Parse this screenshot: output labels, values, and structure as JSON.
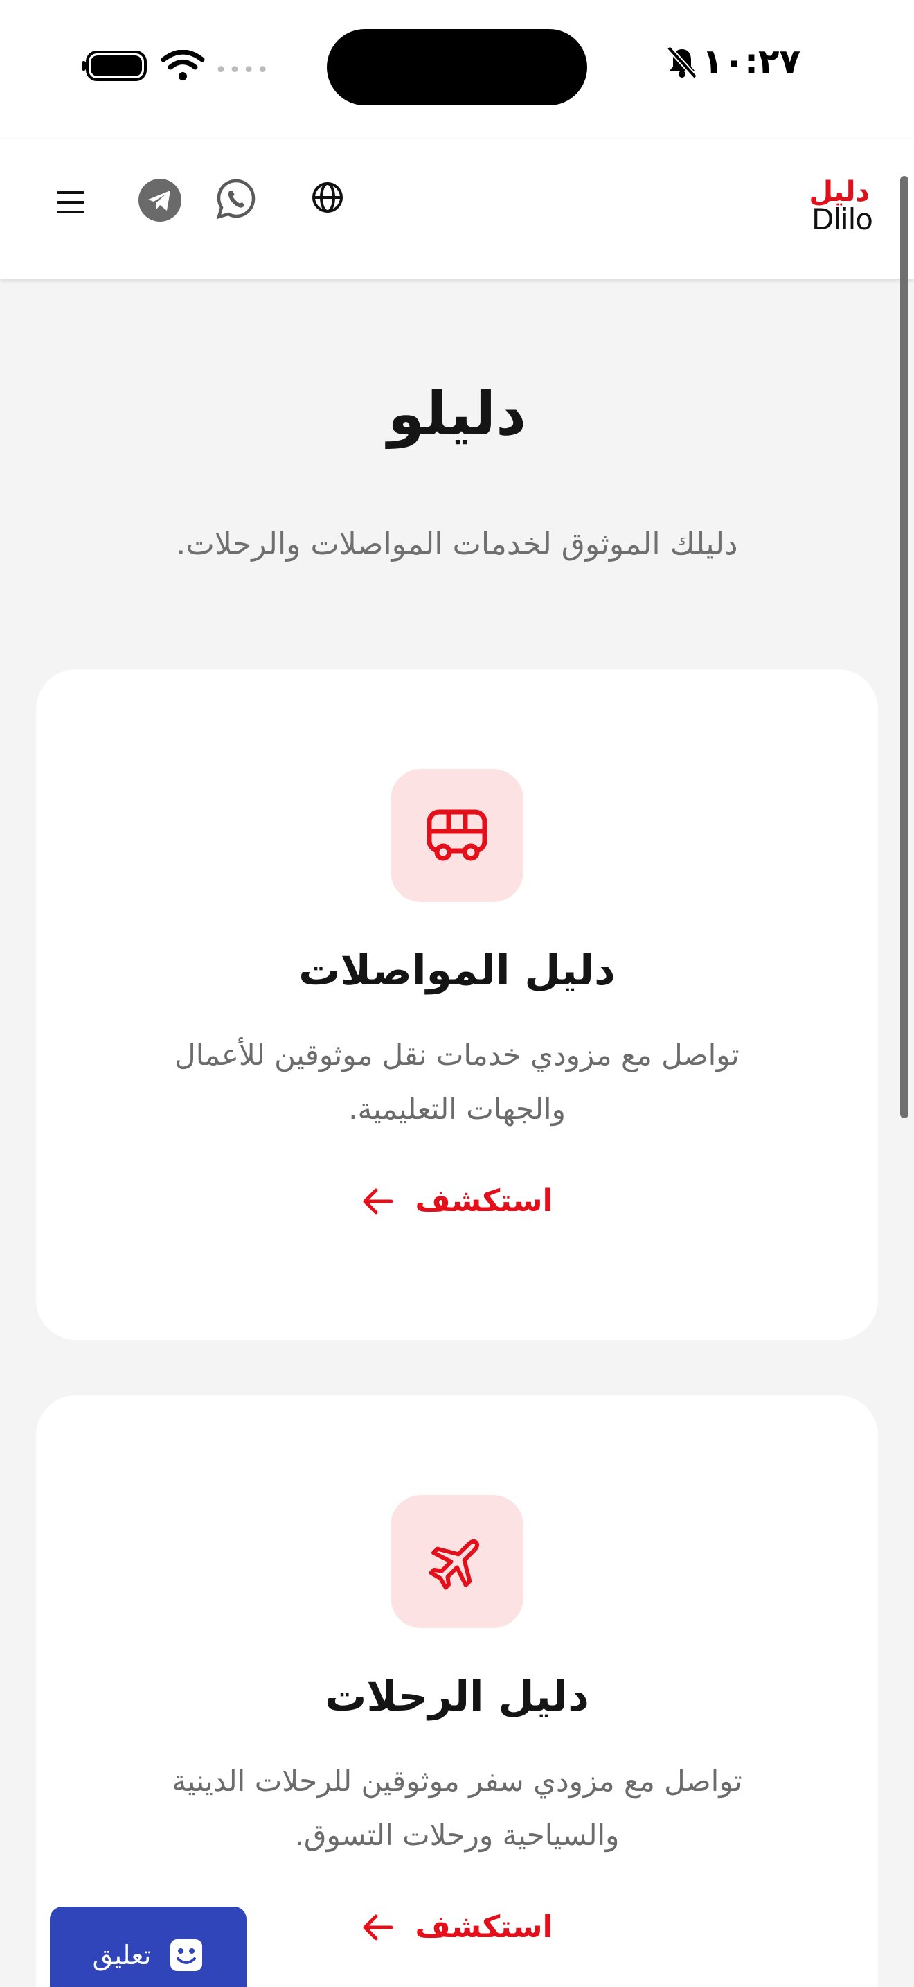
{
  "status_bar": {
    "time": "١٠:٢٧"
  },
  "header": {
    "logo_ar": "دليل",
    "logo_en": "Dlilo",
    "menu_icon": "hamburger-menu-icon",
    "telegram_icon": "telegram-icon",
    "whatsapp_icon": "whatsapp-icon",
    "language_icon": "globe-icon"
  },
  "hero": {
    "title": "دليلو",
    "subtitle": "دليلك الموثوق لخدمات المواصلات والرحلات."
  },
  "cards": [
    {
      "icon": "bus-icon",
      "title": "دليل المواصلات",
      "description": "تواصل مع مزودي خدمات نقل موثوقين للأعمال والجهات التعليمية.",
      "link": "استكشف"
    },
    {
      "icon": "airplane-icon",
      "title": "دليل الرحلات",
      "description": "تواصل مع مزودي سفر موثوقين للرحلات الدينية والسياحية ورحلات التسوق.",
      "link": "استكشف"
    }
  ],
  "feedback": {
    "label": "تعليق"
  },
  "colors": {
    "brand_red": "#e3101b",
    "icon_tile_bg": "#fde2e3",
    "feedback_blue": "#2f45b9",
    "page_bg": "#f4f4f4"
  }
}
